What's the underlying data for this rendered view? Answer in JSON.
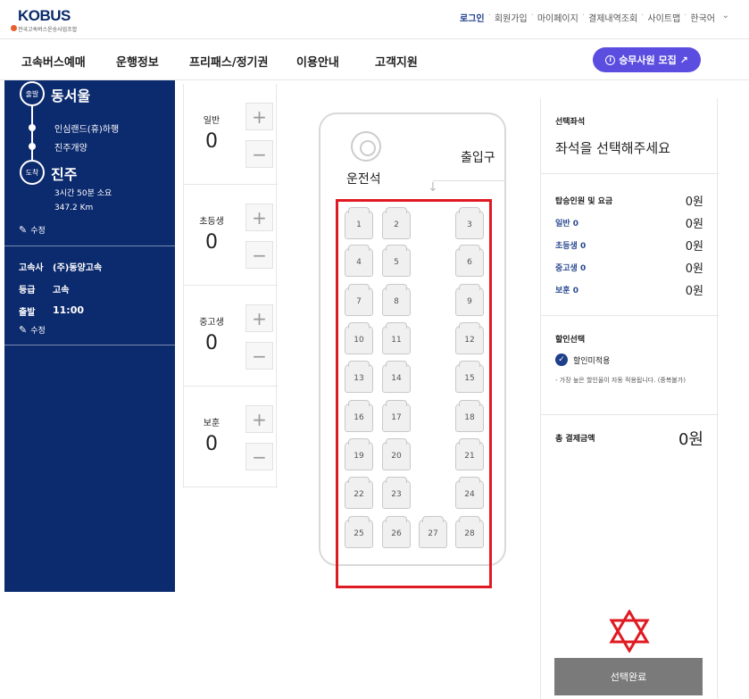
{
  "header": {
    "logo_text": "KOBUS",
    "logo_sub": "전국고속버스운송사업조합",
    "util": [
      "로그인",
      "회원가입",
      "마이페이지",
      "결제내역조회",
      "사이트맵",
      "한국어"
    ]
  },
  "nav": {
    "items": [
      "고속버스예매",
      "운행정보",
      "프리패스/정기권",
      "이용안내",
      "고객지원"
    ],
    "recruit": "승무사원 모집 ↗"
  },
  "route": {
    "depart_badge": "출발",
    "depart": "동서울",
    "vias": [
      "인심랜드(휴)하행",
      "진주개양"
    ],
    "arrive_badge": "도착",
    "arrive": "진주",
    "duration": "3시간 50분 소요",
    "distance": "347.2 Km",
    "edit1": "수정",
    "company_label": "고속사",
    "company": "(주)동양고속",
    "grade_label": "등급",
    "grade": "고속",
    "time_label": "출발",
    "time": "11:00",
    "edit2": "수정"
  },
  "passengers": [
    {
      "label": "일반",
      "count": "0"
    },
    {
      "label": "초등생",
      "count": "0"
    },
    {
      "label": "중고생",
      "count": "0"
    },
    {
      "label": "보훈",
      "count": "0"
    }
  ],
  "bus": {
    "driver": "운전석",
    "door": "출입구",
    "seats": [
      "1",
      "2",
      "3",
      "4",
      "5",
      "6",
      "7",
      "8",
      "9",
      "10",
      "11",
      "12",
      "13",
      "14",
      "15",
      "16",
      "17",
      "18",
      "19",
      "20",
      "21",
      "22",
      "23",
      "24",
      "25",
      "26",
      "27",
      "28"
    ]
  },
  "summary": {
    "selected_title": "선택좌석",
    "selected_text": "좌석을 선택해주세요",
    "fare_title": "탑승인원 및 요금",
    "fare_total": "0원",
    "fares": [
      {
        "label": "일반 0",
        "amount": "0원"
      },
      {
        "label": "초등생 0",
        "amount": "0원"
      },
      {
        "label": "중고생 0",
        "amount": "0원"
      },
      {
        "label": "보훈 0",
        "amount": "0원"
      }
    ],
    "discount_title": "할인선택",
    "discount_option": "할인미적용",
    "discount_note": "- 가장 높은 할인율이 자동 적용됩니다. (중복불가)",
    "total_label": "총 결제금액",
    "total_amount": "0원",
    "done": "선택완료"
  },
  "colors": {
    "navy": "#0c2a6e",
    "accent": "#5a4de0",
    "highlight": "#e01a22"
  }
}
